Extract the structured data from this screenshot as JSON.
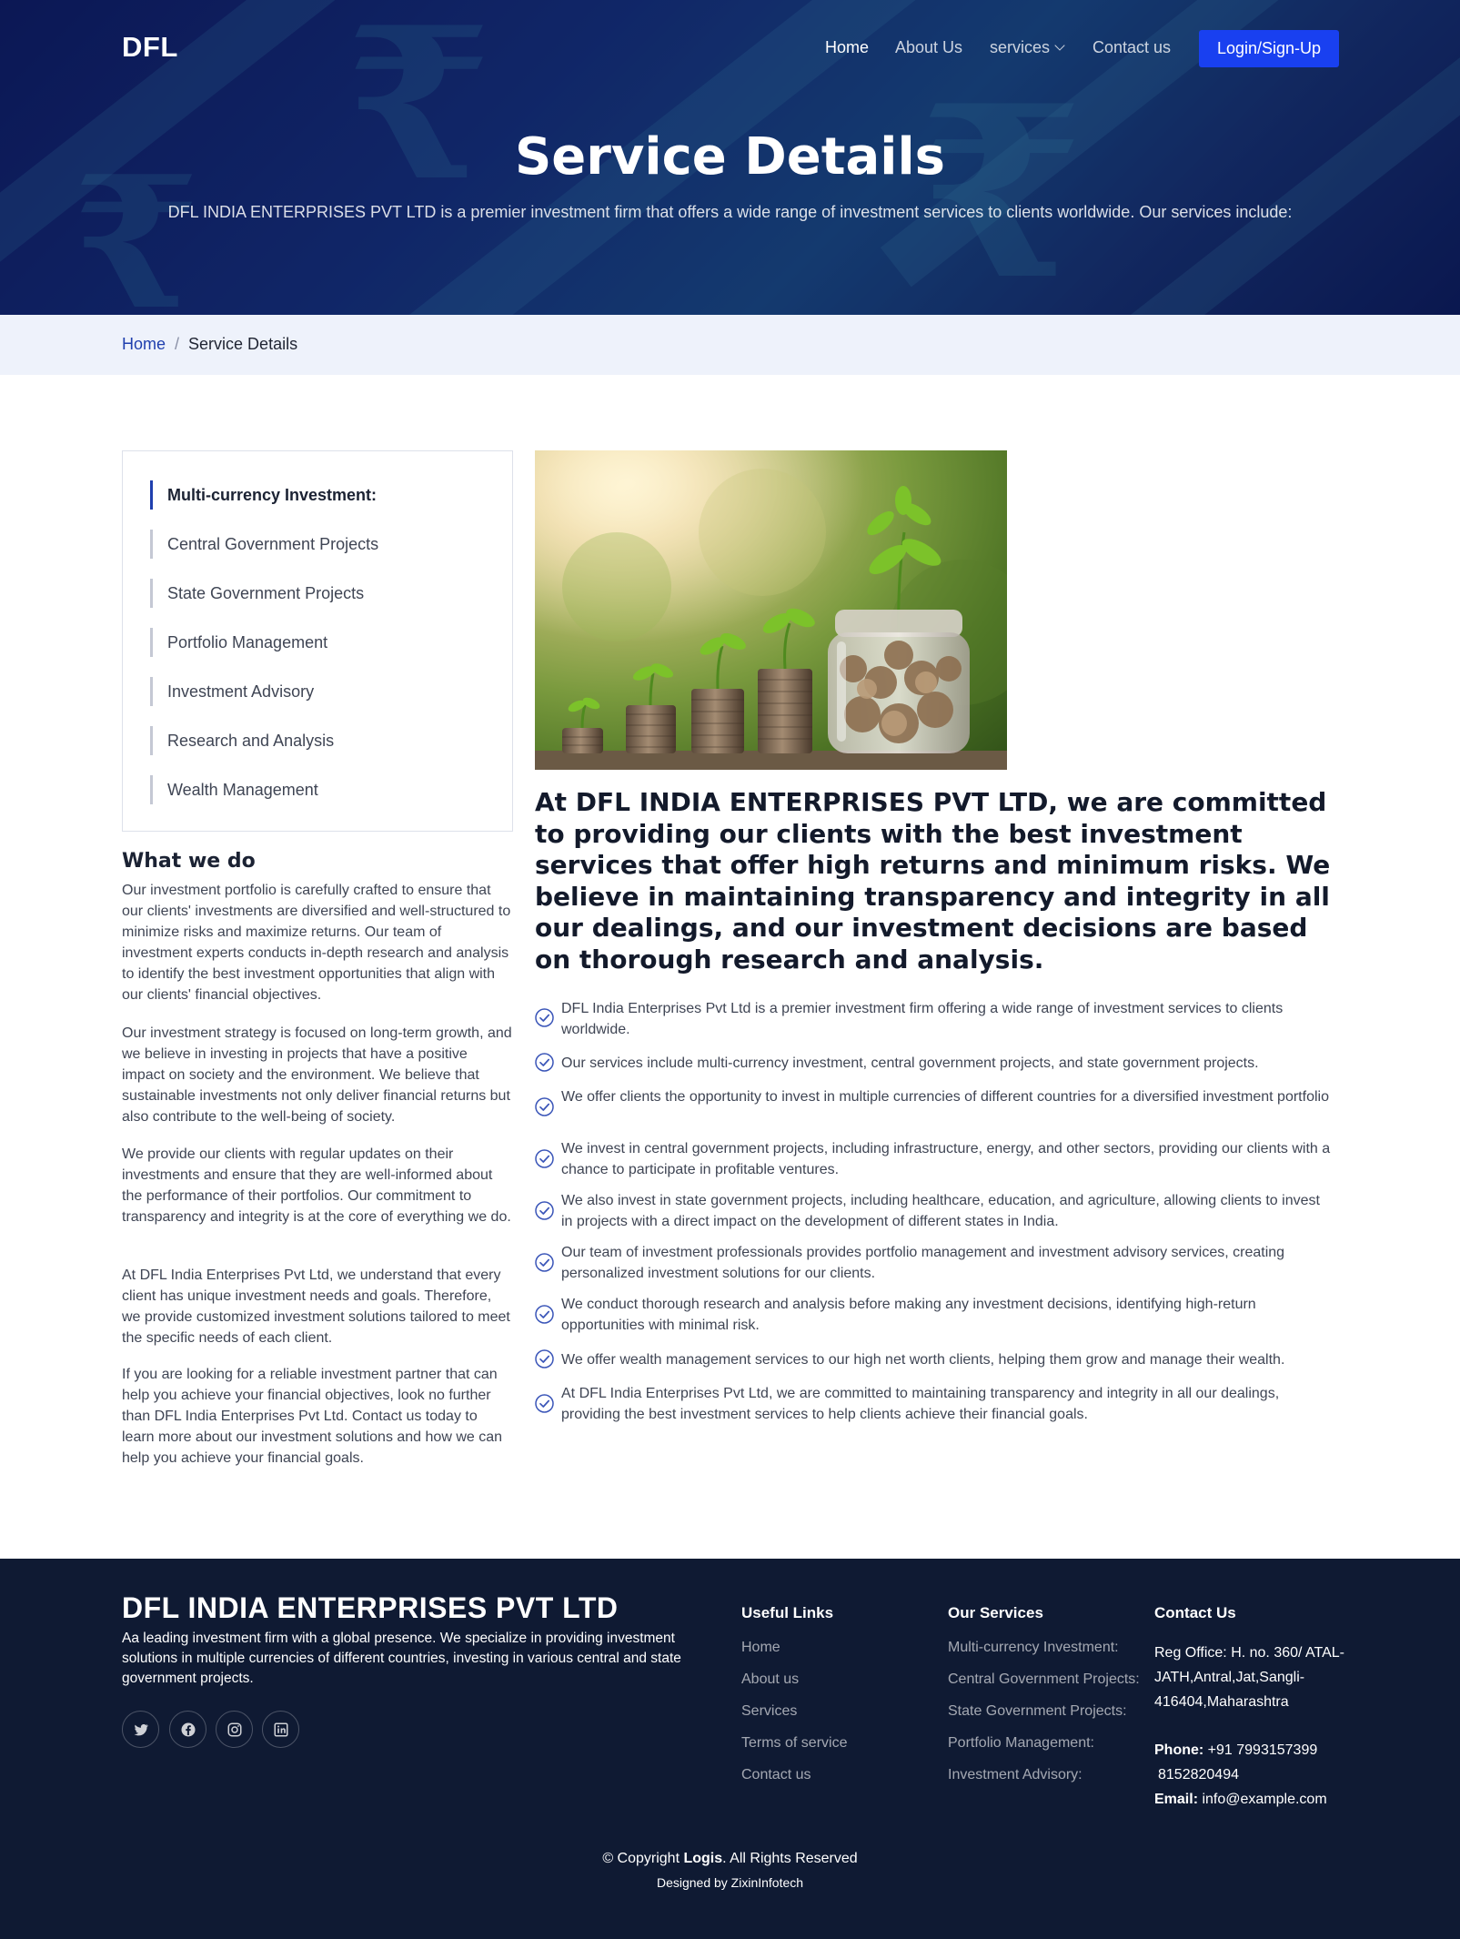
{
  "header": {
    "logo": "DFL",
    "nav": [
      {
        "label": "Home",
        "active": true
      },
      {
        "label": "About Us",
        "active": false
      },
      {
        "label": "services",
        "active": false,
        "has_dropdown": true
      },
      {
        "label": "Contact us",
        "active": false
      }
    ],
    "login_button": "Login/Sign-Up"
  },
  "hero": {
    "title": "Service Details",
    "subtitle": "DFL INDIA ENTERPRISES PVT LTD is a premier investment firm that offers a wide range of investment services to clients worldwide. Our services include:",
    "background_glyph": "₹"
  },
  "breadcrumb": {
    "home": "Home",
    "separator": "/",
    "current": "Service Details"
  },
  "sidebar": {
    "services": [
      {
        "label": "Multi-currency Investment:",
        "active": true
      },
      {
        "label": "Central Government Projects",
        "active": false
      },
      {
        "label": "State Government Projects",
        "active": false
      },
      {
        "label": "Portfolio Management",
        "active": false
      },
      {
        "label": "Investment Advisory",
        "active": false
      },
      {
        "label": "Research and Analysis",
        "active": false
      },
      {
        "label": "Wealth Management",
        "active": false
      }
    ],
    "what_we_do_title": "What we do",
    "paragraphs": [
      "Our investment portfolio is carefully crafted to ensure that our clients' investments are diversified and well-structured to minimize risks and maximize returns. Our team of investment experts conducts in-depth research and analysis to identify the best investment opportunities that align with our clients' financial objectives.",
      "Our investment strategy is focused on long-term growth, and we believe in investing in projects that have a positive impact on society and the environment. We believe that sustainable investments not only deliver financial returns but also contribute to the well-being of society.",
      "We provide our clients with regular updates on their investments and ensure that they are well-informed about the performance of their portfolios. Our commitment to transparency and integrity is at the core of everything we do.",
      "At DFL India Enterprises Pvt Ltd, we understand that every client has unique investment needs and goals. Therefore, we provide customized investment solutions tailored to meet the specific needs of each client.",
      "If you are looking for a reliable investment partner that can help you achieve your financial objectives, look no further than DFL India Enterprises Pvt Ltd. Contact us today to learn more about our investment solutions and how we can help you achieve your financial goals."
    ]
  },
  "main": {
    "heading": "At DFL INDIA ENTERPRISES PVT LTD, we are committed to providing our clients with the best investment services that offer high returns and minimum risks. We believe in maintaining transparency and integrity in all our dealings, and our investment decisions are based on thorough research and analysis.",
    "points": [
      "DFL India Enterprises Pvt Ltd is a premier investment firm offering a wide range of investment services to clients worldwide.",
      "Our services include multi-currency investment, central government projects, and state government projects.",
      "We offer clients the opportunity to invest in multiple currencies of different countries for a diversified investment portfolio",
      "We invest in central government projects, including infrastructure, energy, and other sectors, providing our clients with a chance to participate in profitable ventures.",
      "We also invest in state government projects, including healthcare, education, and agriculture, allowing clients to invest in projects with a direct impact on the development of different states in India.",
      "Our team of investment professionals provides portfolio management and investment advisory services, creating personalized investment solutions for our clients.",
      "We conduct thorough research and analysis before making any investment decisions, identifying high-return opportunities with minimal risk.",
      "We offer wealth management services to our high net worth clients, helping them grow and manage their wealth.",
      "At DFL India Enterprises Pvt Ltd, we are committed to maintaining transparency and integrity in all our dealings, providing the best investment services to help clients achieve their financial goals."
    ]
  },
  "footer": {
    "brand": "DFL INDIA ENTERPRISES PVT LTD",
    "description": "Aa leading investment firm with a global presence. We specialize in providing investment solutions in multiple currencies of different countries, investing in various central and state government projects.",
    "social_icons": [
      "twitter-icon",
      "facebook-icon",
      "instagram-icon",
      "linkedin-icon"
    ],
    "useful_links_title": "Useful Links",
    "useful_links": [
      "Home",
      "About us",
      "Services",
      "Terms of service",
      "Contact us"
    ],
    "our_services_title": "Our Services",
    "our_services": [
      "Multi-currency Investment:",
      "Central Government Projects:",
      "State Government Projects:",
      "Portfolio Management:",
      "Investment Advisory:"
    ],
    "contact_title": "Contact Us",
    "reg_office_lines": [
      "Reg Office: H. no. 360/ ATAL-",
      "JATH,Antral,Jat,Sangli-",
      "416404,Maharashtra"
    ],
    "phone_label": "Phone:",
    "phone_1": "+91 7993157399",
    "phone_2": "8152820494",
    "email_label": "Email:",
    "email": "info@example.com",
    "copyright_prefix": "© Copyright",
    "copyright_brand": "Logis",
    "copyright_suffix": ". All Rights Reserved",
    "designed_by": "Designed by ZixinInfotech"
  },
  "colors": {
    "accent": "#1940f0",
    "link_blue": "#1f3fae",
    "hero_dark": "#0e1a5e",
    "footer_bg": "#0f1a33",
    "breadcrumb_bg": "#eef2fb",
    "check_icon": "#3a55b8"
  }
}
